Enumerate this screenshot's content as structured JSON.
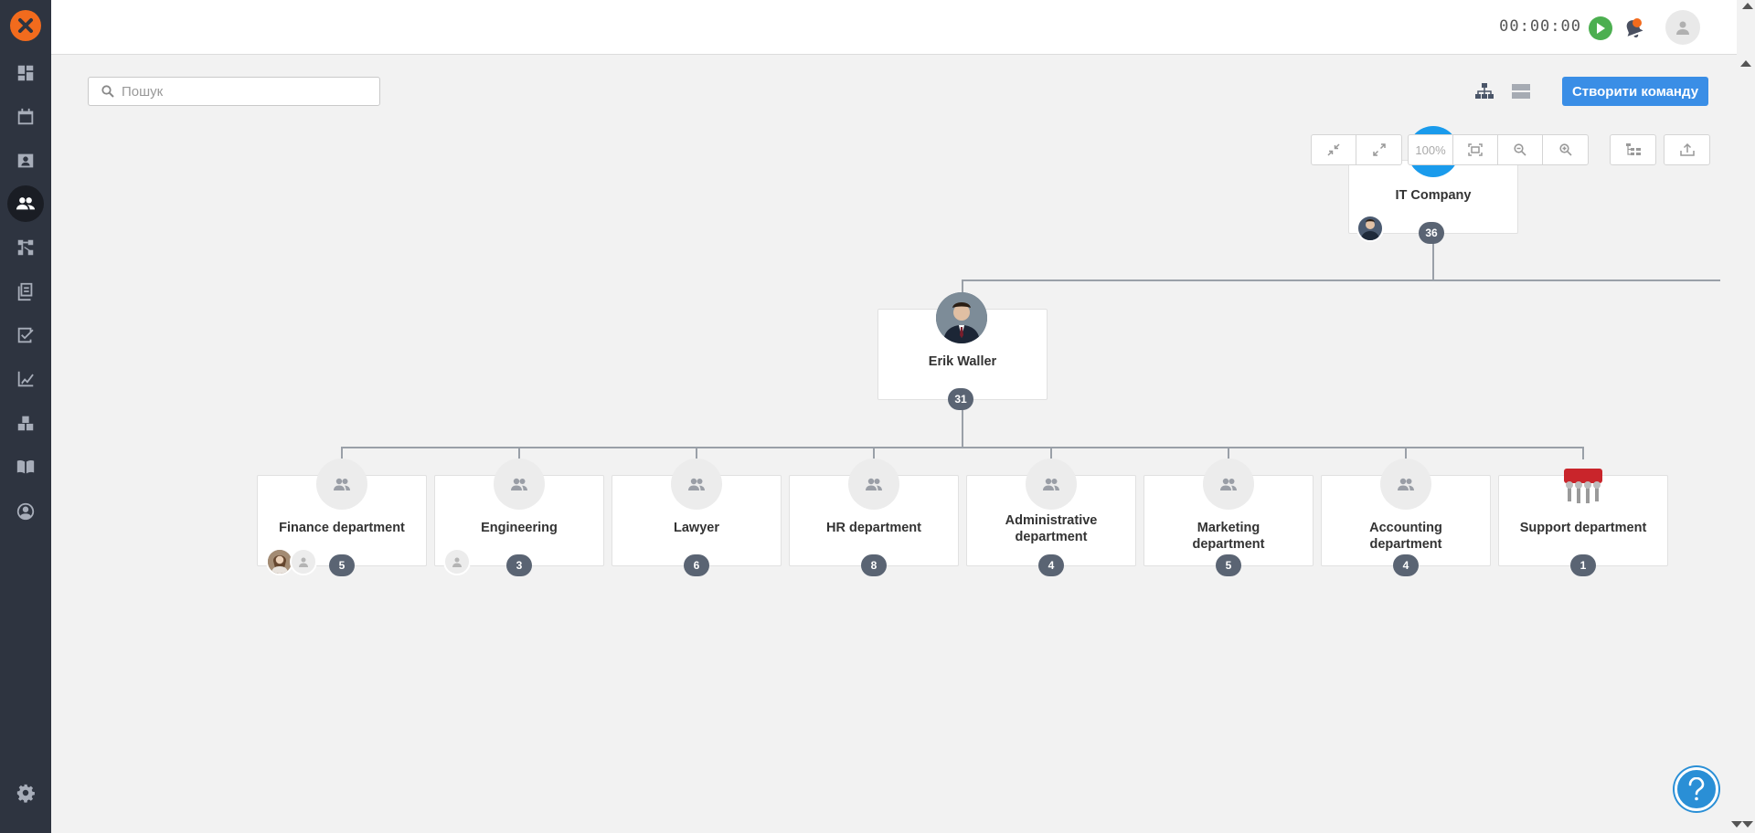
{
  "header": {
    "timer": "00:00:00"
  },
  "toolbar": {
    "search_placeholder": "Пошук",
    "create_button": "Створити команду",
    "zoom_level": "100%"
  },
  "sidebar": {
    "items": [
      {
        "icon": "dashboard-icon"
      },
      {
        "icon": "calendar-icon"
      },
      {
        "icon": "contacts-icon"
      },
      {
        "icon": "team-icon",
        "active": true
      },
      {
        "icon": "workflow-icon"
      },
      {
        "icon": "documents-icon"
      },
      {
        "icon": "tasks-icon"
      },
      {
        "icon": "analytics-icon"
      },
      {
        "icon": "warehouse-icon"
      },
      {
        "icon": "knowledge-base-icon"
      },
      {
        "icon": "profile-icon"
      }
    ],
    "settings_icon": "gear-icon"
  },
  "org": {
    "root": {
      "name": "IT Company",
      "count": "36"
    },
    "manager": {
      "name": "Erik Waller",
      "count": "31"
    },
    "departments": [
      {
        "name": "Finance department",
        "count": "5"
      },
      {
        "name": "Engineering",
        "count": "3"
      },
      {
        "name": "Lawyer",
        "count": "6"
      },
      {
        "name": "HR department",
        "count": "8"
      },
      {
        "name": "Administrative department",
        "count": "4"
      },
      {
        "name": "Marketing department",
        "count": "5"
      },
      {
        "name": "Accounting department",
        "count": "4"
      },
      {
        "name": "Support department",
        "count": "1"
      }
    ]
  },
  "colors": {
    "accent": "#3a8ee6",
    "logo": "#f26b1d",
    "sidebar": "#2e3440",
    "badge": "#5a6473"
  }
}
